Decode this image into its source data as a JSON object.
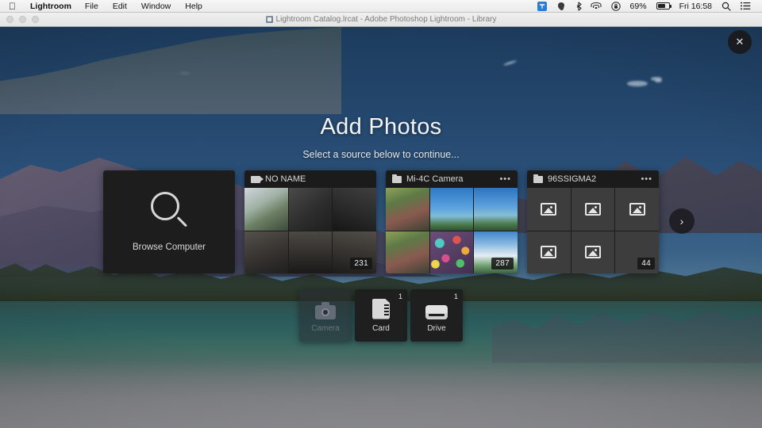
{
  "menubar": {
    "apple_icon": "apple-logo-icon",
    "app_name": "Lightroom",
    "items": [
      "File",
      "Edit",
      "Window",
      "Help"
    ],
    "status": {
      "evernote_icon": "evernote-icon",
      "dropbox_icon": "dropbox-icon",
      "bluetooth_icon": "bluetooth-icon",
      "wifi_icon": "wifi-icon",
      "vpn_icon": "vpn-lock-icon",
      "battery_percent": "69%",
      "battery_icon": "battery-icon",
      "clock": "Fri 16:58",
      "spotlight_icon": "search-icon",
      "notification_icon": "notification-center-icon"
    }
  },
  "window": {
    "title": "Lightroom Catalog.lrcat - Adobe Photoshop Lightroom - Library",
    "doc_icon": "lrcat-document-icon",
    "traffic_lights": [
      "close",
      "minimize",
      "zoom"
    ]
  },
  "overlay": {
    "close_label": "✕",
    "close_icon": "close-icon",
    "title": "Add Photos",
    "subtitle": "Select a source below to continue...",
    "next_arrow": "›",
    "next_arrow_icon": "chevron-right-icon"
  },
  "browse_card": {
    "icon": "magnifier-icon",
    "label": "Browse Computer"
  },
  "sources": [
    {
      "name": "NO NAME",
      "icon": "videocamera-icon",
      "has_menu": false,
      "menu_label": "",
      "count": "231",
      "thumbs": [
        "t-street",
        "t-dark1",
        "t-dark2",
        "t-flat1",
        "t-flat2",
        "t-flat3"
      ],
      "placeholder": false
    },
    {
      "name": "Mi-4C Camera",
      "icon": "folder-icon",
      "has_menu": true,
      "menu_label": "•••",
      "count": "287",
      "thumbs": [
        "t-moto",
        "t-sky",
        "t-sky2",
        "t-moto",
        "t-flowers",
        "t-cloud"
      ],
      "placeholder": false
    },
    {
      "name": "96SSIGMA2",
      "icon": "folder-icon",
      "has_menu": true,
      "menu_label": "•••",
      "count": "44",
      "thumbs": [
        "t-blank",
        "t-blank",
        "t-blank",
        "t-blank",
        "t-blank",
        "t-blank"
      ],
      "placeholder": true
    }
  ],
  "tabs": [
    {
      "label": "Camera",
      "icon": "camera-icon",
      "badge": "",
      "disabled": true
    },
    {
      "label": "Card",
      "icon": "sdcard-icon",
      "badge": "1",
      "disabled": false
    },
    {
      "label": "Drive",
      "icon": "drive-icon",
      "badge": "1",
      "disabled": false
    }
  ],
  "colors": {
    "card_bg": "#1b1b1b",
    "overlay_text": "#f2f4f6",
    "menubar_bg": "#f0f0f0",
    "sky_top": "#1d3c5e"
  }
}
